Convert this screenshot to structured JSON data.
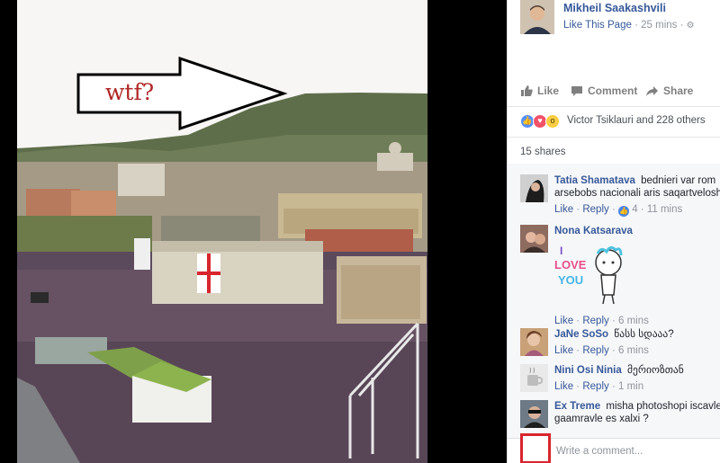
{
  "photo": {
    "annotation_text": "wtf?",
    "annotation_color": "#b12727"
  },
  "post": {
    "page_name": "Mikheil Saakashvili",
    "like_page": "Like This Page",
    "separator": "·",
    "time": "25 mins",
    "privacy_icon": "gear-icon"
  },
  "actions": {
    "like": "Like",
    "comment": "Comment",
    "share": "Share"
  },
  "reactions": {
    "icons": [
      "like",
      "love",
      "wow"
    ],
    "summary": "Victor Tsiklauri and 228 others"
  },
  "shares": "15 shares",
  "comments": [
    {
      "author": "Tatia Shamatava",
      "text": "bednieri var rom arsebobs nacionali aris saqartveloshi",
      "like": "Like",
      "reply": "Reply",
      "reaction_count": "4",
      "time": "11 mins"
    },
    {
      "author": "Nona Katsarava",
      "text": "",
      "sticker_text": [
        "I",
        "LOVE",
        "YOU"
      ],
      "like": "Like",
      "reply": "Reply",
      "time": "6 mins"
    },
    {
      "author": "JaNe SoSo",
      "text": "წასს სდააა?",
      "like": "Like",
      "reply": "Reply",
      "time": "6 mins"
    },
    {
      "author": "Nini Osi Ninia",
      "text": "მერიოზთან",
      "like": "Like",
      "reply": "Reply",
      "time": "1 min"
    },
    {
      "author": "Ex Treme",
      "text": "misha photoshopi iscavle gaamravle es xalxi ?"
    }
  ],
  "composer": {
    "placeholder": "Write a comment..."
  },
  "colors": {
    "link": "#365899",
    "meta": "#90949c",
    "flag_red": "#d7262d",
    "like_blue": "#5890ff",
    "love_red": "#f25268",
    "wow_yellow": "#fbcd44"
  }
}
